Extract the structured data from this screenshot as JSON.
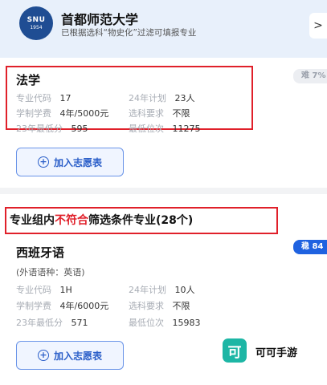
{
  "header": {
    "logo_text": "SNU",
    "logo_sub": "1954",
    "university": "首都师范大学",
    "subtitle": "已根据选科“物史化”过滤可填报专业",
    "close_label": ">"
  },
  "majors": [
    {
      "name": "法学",
      "badge": "难 7%",
      "code_label": "专业代码",
      "code": "17",
      "plan_label": "24年计划",
      "plan": "23人",
      "tuition_label": "学制学费",
      "tuition": "4年/5000元",
      "req_label": "选科要求",
      "req": "不限",
      "minscore_label": "23年最低分",
      "minscore": "595",
      "minrank_label": "最低位次",
      "minrank": "11275",
      "add_label": "加入志愿表"
    },
    {
      "name": "西班牙语",
      "lang_note": "(外语语种：英语)",
      "badge": "稳 84",
      "code_label": "专业代码",
      "code": "1H",
      "plan_label": "24年计划",
      "plan": "10人",
      "tuition_label": "学制学费",
      "tuition": "4年/6000元",
      "req_label": "选科要求",
      "req": "不限",
      "minscore_label": "23年最低分",
      "minscore": "571",
      "minrank_label": "最低位次",
      "minrank": "15983",
      "add_label": "加入志愿表"
    }
  ],
  "section": {
    "part1": "专业组内",
    "part2": "不符合",
    "part3": "筛选条件专业(28个)"
  },
  "watermark": {
    "icon_char": "可",
    "text": "可可手游"
  },
  "colors": {
    "accent": "#2b5fc9",
    "highlight_red": "#e0202a",
    "safe_badge": "#1f62e0"
  }
}
